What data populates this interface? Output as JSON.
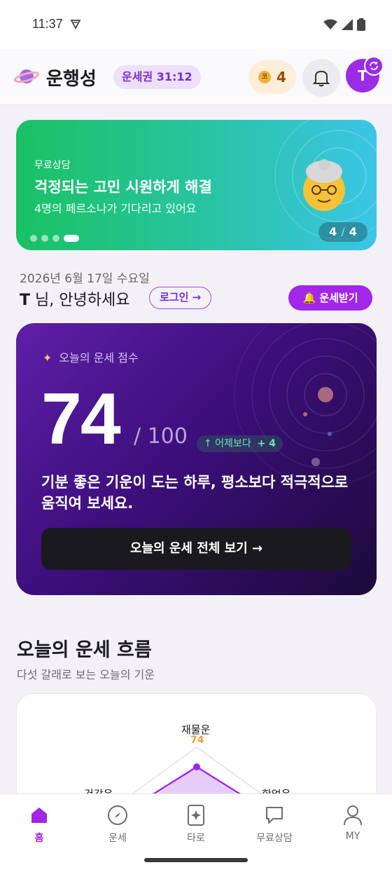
{
  "status_bar": {
    "time": "11:37"
  },
  "header": {
    "title": "운행성",
    "pass_badge": "운세권 31:12",
    "coin_symbol": "코",
    "coins": "4",
    "avatar_initial": "T"
  },
  "banner": {
    "tag": "무료상담",
    "title": "걱정되는 고민 시원하게 해결",
    "subtitle": "4명의 페르소나가 기다리고 있어요",
    "page_current": "4",
    "page_total": "4",
    "dots": 4,
    "active_dot": 4
  },
  "greeting": {
    "date": "2026년 6월 17일 수요일",
    "user_initial": "T",
    "message": " 님, 안녕하세요",
    "login_label": "로그인 →",
    "fortune_button": "🔔 운세받기"
  },
  "score_card": {
    "label": "오늘의 운세 점수",
    "score": "74",
    "max": "/ 100",
    "delta_prefix": "↑ 어제보다",
    "delta_value": "+ 4",
    "description": "기분 좋은 기운이 도는 하루, 평소보다 적극적으로 움직여 보세요.",
    "action_label": "오늘의 운세 전체 보기  →"
  },
  "flow_section": {
    "title": "오늘의 운세 흐름",
    "subtitle": "다섯 갈래로 보는 오늘의 기운",
    "axes": [
      {
        "label": "재물운",
        "value": "74"
      },
      {
        "label": "건강운"
      },
      {
        "label": "학업운"
      }
    ]
  },
  "bottom_nav": {
    "items": [
      {
        "label": "홈",
        "icon": "home-icon",
        "active": true
      },
      {
        "label": "운세",
        "icon": "compass-icon",
        "active": false
      },
      {
        "label": "타로",
        "icon": "tarot-card-icon",
        "active": false
      },
      {
        "label": "무료상담",
        "icon": "chat-bubble-icon",
        "active": false
      },
      {
        "label": "MY",
        "icon": "person-icon",
        "active": false
      }
    ]
  },
  "colors": {
    "accent": "#a327e8",
    "banner_start": "#1ac164",
    "banner_end": "#3bc5e6",
    "card_dark": "#3d0f7c",
    "positive": "#6ee7a5"
  }
}
